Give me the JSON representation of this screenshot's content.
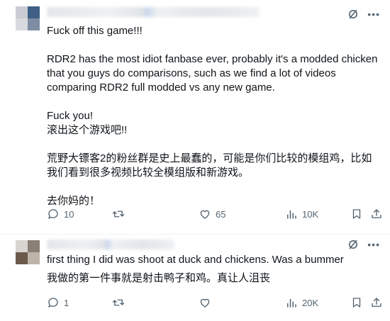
{
  "tweets": [
    {
      "paragraphs": [
        "Fuck off this game!!!",
        "",
        "RDR2 has the most idiot fanbase ever, probably it's a modded chicken that you guys do comparisons, such as we find a lot of videos comparing RDR2 full modded vs any new game.",
        "",
        "Fuck you!",
        "滚出这个游戏吧!!",
        "",
        "荒野大镖客2的粉丝群是史上最蠢的，可能是你们比较的模组鸡，比如我们看到很多视频比较全模组版和新游戏。",
        "",
        "去你妈的！"
      ],
      "stats": {
        "replies": "10",
        "reposts": "",
        "likes": "65",
        "views": "10K"
      }
    },
    {
      "paragraphs": [
        "first thing I did was shoot at duck and chickens. Was a bummer",
        "我做的第一件事就是射击鸭子和鸡。真让人沮丧"
      ],
      "stats": {
        "replies": "1",
        "reposts": "",
        "likes": "",
        "views": "20K"
      }
    }
  ],
  "icons": {
    "top": [
      "grok-icon",
      "more-icon"
    ],
    "actions": [
      "reply-icon",
      "repost-icon",
      "like-icon",
      "views-icon",
      "bookmark-icon",
      "share-icon"
    ]
  },
  "colors": {
    "text": "#0f1419",
    "secondary": "#536471",
    "border": "#eff3f4"
  }
}
